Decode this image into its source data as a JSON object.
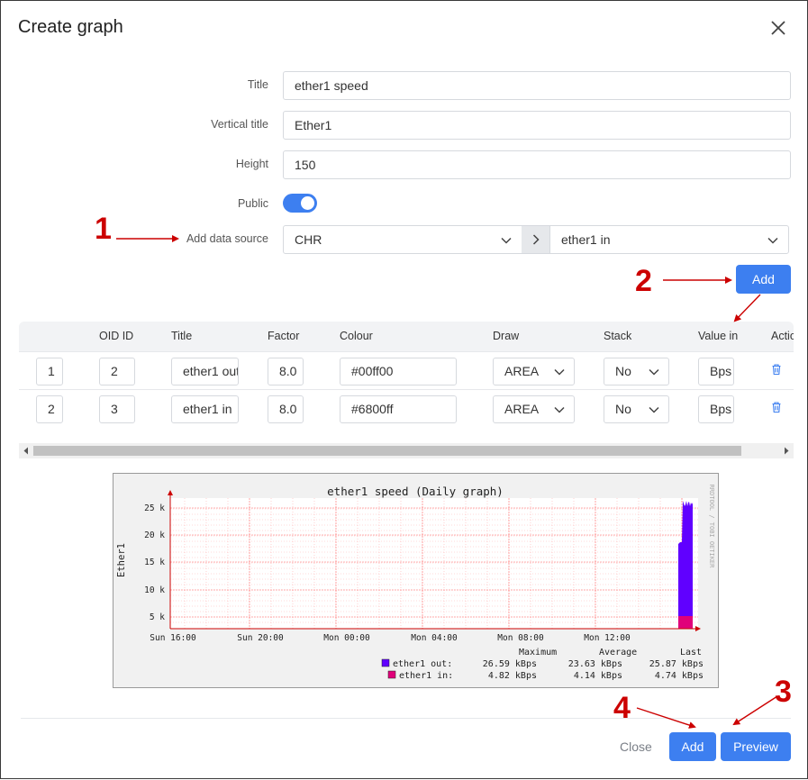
{
  "dialog": {
    "title": "Create graph"
  },
  "form": {
    "title_label": "Title",
    "title_value": "ether1 speed",
    "vtitle_label": "Vertical title",
    "vtitle_value": "Ether1",
    "height_label": "Height",
    "height_value": "150",
    "public_label": "Public",
    "public_on": true,
    "datasource_label": "Add data source",
    "datasource_device": "CHR",
    "datasource_oid": "ether1 in",
    "add_button": "Add"
  },
  "table": {
    "headers": [
      "OID ID",
      "Title",
      "Factor",
      "Colour",
      "Draw",
      "Stack",
      "Value in",
      "Actions"
    ],
    "rows": [
      {
        "index": "1",
        "oid": "2",
        "title": "ether1 out",
        "factor": "8.0",
        "colour": "#00ff00",
        "draw": "AREA",
        "stack": "No",
        "value_in": "Bps"
      },
      {
        "index": "2",
        "oid": "3",
        "title": "ether1 in",
        "factor": "8.0",
        "colour": "#6800ff",
        "draw": "AREA",
        "stack": "No",
        "value_in": "Bps"
      }
    ]
  },
  "graph": {
    "title": "ether1 speed (Daily graph)",
    "vertical_title": "Ether1",
    "side_label": "RRDTOOL / TOBI OETIKER",
    "y_ticks": [
      "25 k",
      "20 k",
      "15 k",
      "10 k",
      "5 k"
    ],
    "x_ticks": [
      "Sun 16:00",
      "Sun 20:00",
      "Mon 00:00",
      "Mon 04:00",
      "Mon 08:00",
      "Mon 12:00"
    ],
    "legend_headers": [
      "Maximum",
      "Average",
      "Last"
    ],
    "legend": [
      {
        "name": "ether1 out:",
        "max": "26.59 kBps",
        "avg": "23.63 kBps",
        "last": "25.87 kBps",
        "color": "#6000ff"
      },
      {
        "name": "ether1 in:",
        "max": "4.82 kBps",
        "avg": "4.14 kBps",
        "last": "4.74 kBps",
        "color": "#e0007a"
      }
    ]
  },
  "footer": {
    "close": "Close",
    "add": "Add",
    "preview": "Preview"
  },
  "annotations": [
    "1",
    "2",
    "3",
    "4"
  ],
  "colors": {
    "accent": "#3d7ff0",
    "annotation": "#cc0000"
  }
}
